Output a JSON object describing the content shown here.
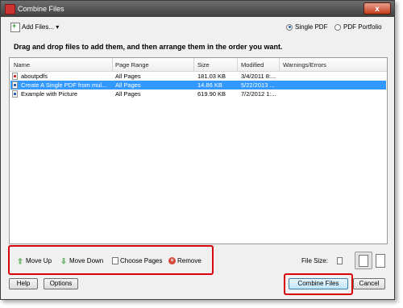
{
  "window": {
    "title": "Combine Files",
    "close_glyph": "x"
  },
  "header": {
    "add_files_label": "Add Files...",
    "add_files_arrow": "▾",
    "radio_single": "Single PDF",
    "radio_portfolio": "PDF Portfolio",
    "selected_output": "Single PDF"
  },
  "instructions": "Drag and drop files to add them, and then arrange them in the order you want.",
  "table": {
    "columns": [
      "Name",
      "Page Range",
      "Size",
      "Modified",
      "Warnings/Errors"
    ],
    "rows": [
      {
        "name": "aboutpdfs",
        "page_range": "All Pages",
        "size": "181.03 KB",
        "modified": "3/4/2011 8:...",
        "warnings": "",
        "icon": "pdf-file-icon",
        "selected": false
      },
      {
        "name": "Create A Single PDF from mul...",
        "page_range": "All Pages",
        "size": "14.86 KB",
        "modified": "5/22/2013 ...",
        "warnings": "",
        "icon": "word-file-icon",
        "selected": true
      },
      {
        "name": "Example with Picture",
        "page_range": "All Pages",
        "size": "619.90 KB",
        "modified": "7/2/2012 1:...",
        "warnings": "",
        "icon": "word-file-icon",
        "selected": false
      }
    ]
  },
  "toolbar": {
    "move_up": "Move Up",
    "move_down": "Move Down",
    "choose_pages": "Choose Pages",
    "remove": "Remove",
    "file_size_label": "File Size:",
    "file_size_selected": "medium"
  },
  "footer": {
    "help": "Help",
    "options": "Options",
    "combine": "Combine Files",
    "cancel": "Cancel"
  },
  "colors": {
    "selection": "#3399ff",
    "highlight": "#d8000c",
    "titlebar": "#4a4a4a"
  }
}
